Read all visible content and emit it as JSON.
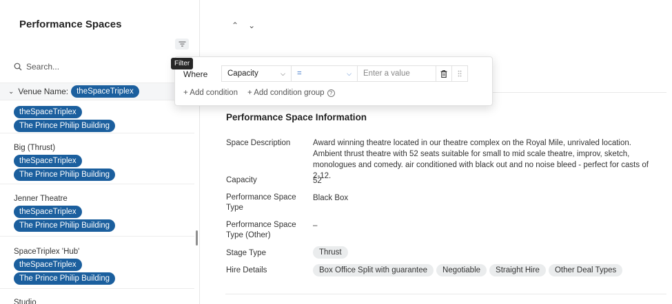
{
  "sidebar": {
    "title": "Performance Spaces",
    "search_placeholder": "Search...",
    "group": {
      "label": "Venue Name:",
      "value": "theSpaceTriplex"
    },
    "records": [
      {
        "name": "",
        "tags": [
          "theSpaceTriplex",
          "The Prince Philip Building"
        ]
      },
      {
        "name": "Big (Thrust)",
        "tags": [
          "theSpaceTriplex",
          "The Prince Philip Building"
        ]
      },
      {
        "name": "Jenner Theatre",
        "tags": [
          "theSpaceTriplex",
          "The Prince Philip Building"
        ]
      },
      {
        "name": "SpaceTriplex 'Hub'",
        "tags": [
          "theSpaceTriplex",
          "The Prince Philip Building"
        ]
      },
      {
        "name": "Studio",
        "tags": []
      }
    ]
  },
  "tooltip": "Filter",
  "filter": {
    "where_label": "Where",
    "field": "Capacity",
    "operator": "=",
    "value_placeholder": "Enter a value",
    "add_condition": "+ Add condition",
    "add_group": "+ Add condition group",
    "help": "?"
  },
  "detail": {
    "nav_up": "^",
    "nav_down": "v",
    "section_title": "Performance Space Information",
    "fields": {
      "space_description": {
        "label": "Space Description",
        "value": "Award winning theatre located in our theatre complex on the Royal Mile, unrivaled location. Ambient thrust theatre with 52 seats suitable for small to mid scale theatre, improv, sketch, monologues and comedy. air conditioned with black out and no noise bleed - perfect for casts of 2-12."
      },
      "capacity": {
        "label": "Capacity",
        "value": "52"
      },
      "space_type": {
        "label": "Performance Space Type",
        "value": "Black Box"
      },
      "space_type_other": {
        "label": "Performance Space Type (Other)",
        "value": "–"
      },
      "stage_type": {
        "label": "Stage Type",
        "value": "Thrust"
      },
      "hire_details": {
        "label": "Hire Details",
        "values": [
          "Box Office Split with guarantee",
          "Negotiable",
          "Straight Hire",
          "Other Deal Types"
        ]
      }
    }
  },
  "colors": {
    "pill_blue": "#1b5f9e",
    "operator_blue": "#3b76c9"
  }
}
